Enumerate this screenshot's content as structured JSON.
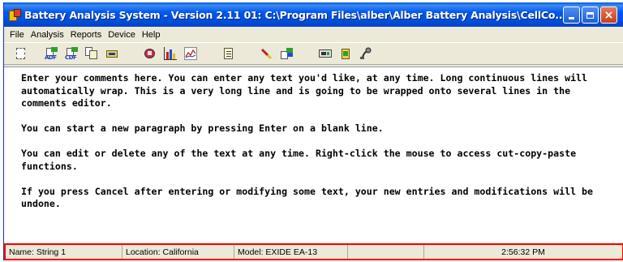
{
  "window": {
    "title": "Battery Analysis System - Version 2.11 01: C:\\Program Files\\alber\\Alber Battery Analysis\\CellCo...",
    "controls": {
      "minimize": "minimize",
      "maximize": "maximize",
      "close": "×"
    }
  },
  "menu": {
    "items": [
      "File",
      "Analysis",
      "Reports",
      "Device",
      "Help"
    ]
  },
  "toolbar": {
    "buttons": [
      {
        "icon": "page-setup-icon"
      },
      {
        "icon": "export-adf-icon",
        "label": "ADF"
      },
      {
        "icon": "export-cdf-icon",
        "label": "CDF"
      },
      {
        "icon": "copy-icon"
      },
      {
        "icon": "device-icon"
      },
      {
        "icon": "report-icon"
      },
      {
        "icon": "bar-chart-icon"
      },
      {
        "icon": "line-chart-icon"
      },
      {
        "icon": "notes-icon"
      },
      {
        "icon": "highlight-icon"
      },
      {
        "icon": "transfer-icon"
      },
      {
        "icon": "meter-icon"
      },
      {
        "icon": "battery-cell-icon"
      },
      {
        "icon": "probe-icon"
      }
    ]
  },
  "comments": {
    "paragraphs": [
      "Enter your comments here. You can enter any text you'd like, at any time. Long continuous lines will automatically wrap. This is a very long line and is going to be wrapped onto several lines in the comments editor.",
      "You can start a new paragraph by pressing Enter on a blank line.",
      "You can edit or delete any of the text at any time. Right-click the mouse to access cut-copy-paste functions.",
      "If you press Cancel after entering or modifying some text, your new entries and modifications will be undone."
    ]
  },
  "status": {
    "name": "Name: String 1",
    "location": "Location: California",
    "model": "Model: EXIDE EA-13",
    "time": "2:56:32 PM"
  },
  "colors": {
    "title_bar": "#0054e3",
    "status_highlight": "#ff0000"
  }
}
